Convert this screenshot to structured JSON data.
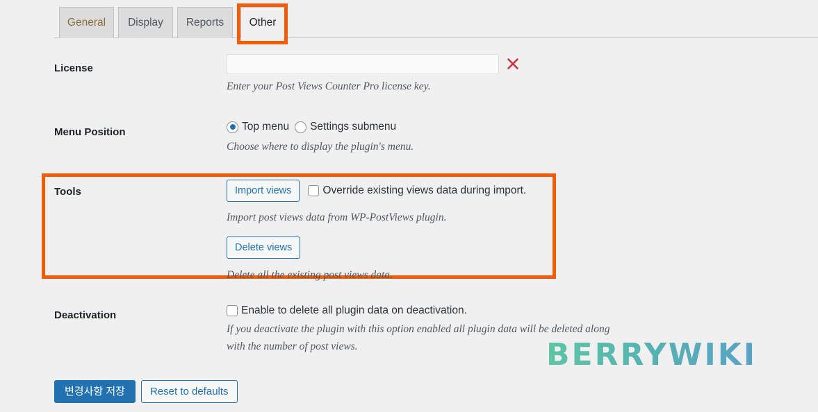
{
  "tabs": [
    {
      "label": "General",
      "state": "hovered"
    },
    {
      "label": "Display",
      "state": "normal"
    },
    {
      "label": "Reports",
      "state": "normal"
    },
    {
      "label": "Other",
      "state": "active"
    }
  ],
  "rows": {
    "license": {
      "label": "License",
      "value": "",
      "placeholder": "",
      "clear_icon": "x-mark-icon",
      "description": "Enter your Post Views Counter Pro license key."
    },
    "menu_position": {
      "label": "Menu Position",
      "options": [
        {
          "label": "Top menu",
          "checked": true
        },
        {
          "label": "Settings submenu",
          "checked": false
        }
      ],
      "description": "Choose where to display the plugin's menu."
    },
    "tools": {
      "label": "Tools",
      "import_button": "Import views",
      "override_checkbox": {
        "label": "Override existing views data during import.",
        "checked": false
      },
      "import_description": "Import post views data from WP-PostViews plugin.",
      "delete_button": "Delete views",
      "delete_description": "Delete all the existing post views data."
    },
    "deactivation": {
      "label": "Deactivation",
      "checkbox": {
        "label": "Enable to delete all plugin data on deactivation.",
        "checked": false
      },
      "description": "If you deactivate the plugin with this option enabled all plugin data will be deleted along with the number of post views."
    }
  },
  "footer": {
    "save_label": "변경사항 저장",
    "reset_label": "Reset to defaults"
  },
  "watermark": {
    "text": "BERRYWIKI"
  },
  "colors": {
    "highlight": "#f25c05",
    "primary": "#2271b1",
    "clear_icon": "#c9323e",
    "background": "#f0f0f0",
    "watermark_start": "#5ec5a5",
    "watermark_end": "#5aa2c6"
  }
}
